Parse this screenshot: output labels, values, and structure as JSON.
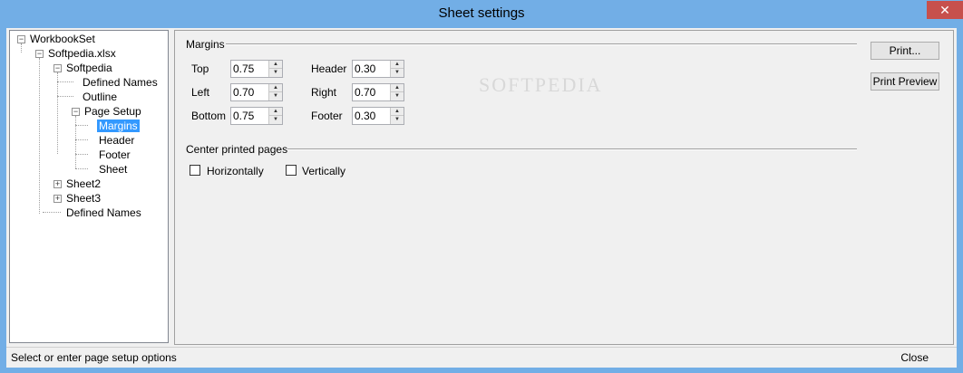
{
  "window": {
    "title": "Sheet settings",
    "close_glyph": "✕"
  },
  "tree": {
    "workbookset": "WorkbookSet",
    "file": "Softpedia.xlsx",
    "sheet1": "Softpedia",
    "defined_names_child": "Defined Names",
    "outline": "Outline",
    "page_setup": "Page Setup",
    "margins": "Margins",
    "header": "Header",
    "footer": "Footer",
    "sheet": "Sheet",
    "sheet2": "Sheet2",
    "sheet3": "Sheet3",
    "defined_names": "Defined Names",
    "expand_glyph": "+",
    "collapse_glyph": "−"
  },
  "margins": {
    "title": "Margins",
    "top_label": "Top",
    "top_value": "0.75",
    "left_label": "Left",
    "left_value": "0.70",
    "bottom_label": "Bottom",
    "bottom_value": "0.75",
    "header_label": "Header",
    "header_value": "0.30",
    "right_label": "Right",
    "right_value": "0.70",
    "footer_label": "Footer",
    "footer_value": "0.30",
    "up_glyph": "▲",
    "down_glyph": "▼"
  },
  "center": {
    "title": "Center printed pages",
    "horizontally": "Horizontally",
    "horizontally_checked": false,
    "vertically": "Vertically",
    "vertically_checked": false
  },
  "buttons": {
    "print": "Print...",
    "print_preview": "Print Preview"
  },
  "status": {
    "text": "Select or enter page setup options",
    "close": "Close"
  },
  "watermark": "SOFTPEDIA"
}
